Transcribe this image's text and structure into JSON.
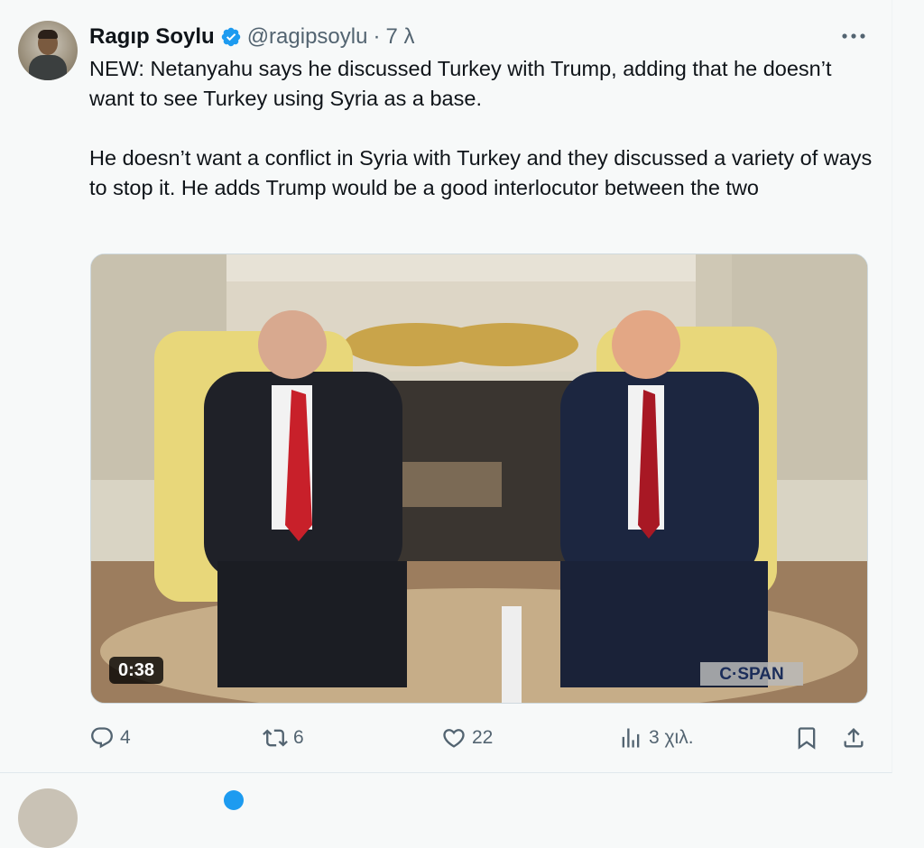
{
  "tweet": {
    "author_name": "Ragıp Soylu",
    "handle": "@ragipsoylu",
    "separator": "·",
    "time": "7 λ",
    "text_paragraphs": [
      "NEW: Netanyahu says he discussed Turkey with Trump, adding that he doesn’t want to see Turkey using Syria as a base.",
      "He doesn’t want a conflict in Syria with Turkey and they discussed a variety of ways to stop it. He adds Trump would be a good interlocutor between the two"
    ],
    "video": {
      "duration": "0:38",
      "watermark": "C·SPAN"
    }
  },
  "actions": {
    "replies": "4",
    "reposts": "6",
    "likes": "22",
    "views": "3 χιλ."
  },
  "colors": {
    "verified": "#1d9bf0",
    "text": "#0f1419",
    "secondary": "#536471",
    "background": "#f7f9f9"
  },
  "icons": [
    "verified-badge-icon",
    "more-icon",
    "reply-icon",
    "repost-icon",
    "like-icon",
    "views-icon",
    "bookmark-icon",
    "share-icon"
  ]
}
